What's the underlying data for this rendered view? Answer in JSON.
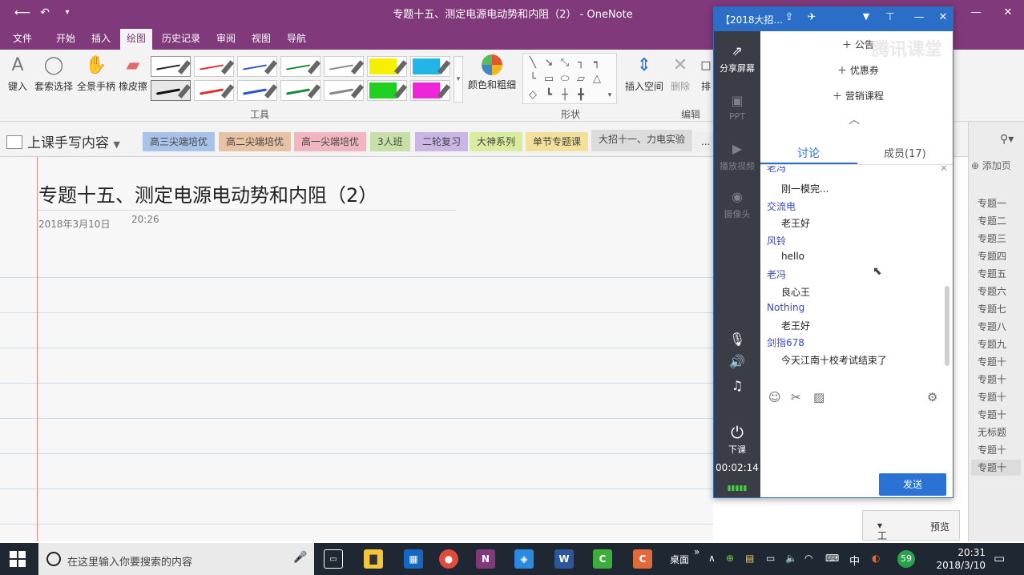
{
  "window": {
    "title": "专题十五、测定电源电动势和内阻（2） - OneNote"
  },
  "ribbon_tabs": [
    "文件",
    "开始",
    "插入",
    "绘图",
    "历史记录",
    "审阅",
    "视图",
    "导航"
  ],
  "ribbon": {
    "tool_buttons": [
      "键入",
      "套索选择",
      "全景手柄",
      "橡皮擦"
    ],
    "group_tools": "工具",
    "color_weight": "颜色和粗细",
    "group_shapes": "形状",
    "insert_space": "插入空间",
    "delete": "删除",
    "arrange": "排",
    "group_edit": "编辑"
  },
  "notebook": {
    "name": "上课手写内容",
    "sections": [
      "高三尖端培优",
      "高二尖端培优",
      "高一尖端培优",
      "3人班",
      "二轮复习",
      "大神系列",
      "单节专题课",
      "大招十一、力电实验",
      "..."
    ],
    "section_colors": [
      "#a7c4e8",
      "#e7c3a3",
      "#f1b6c2",
      "#c6e0a8",
      "#c9b6e4",
      "#d9ec9f",
      "#f3e19b",
      "#dcdcdc",
      "#eeeeee"
    ]
  },
  "page": {
    "title": "专题十五、测定电源电动势和内阻（2）",
    "date": "2018年3月10日",
    "time": "20:26"
  },
  "pagelist": {
    "add_page": "添加页",
    "items": [
      "专题一",
      "专题二",
      "专题三",
      "专题四",
      "专题五",
      "专题六",
      "专题七",
      "专题八",
      "专题九",
      "专题十",
      "专题十",
      "专题十",
      "专题十",
      "无标题",
      "专题十",
      "专题十"
    ]
  },
  "bottom": {
    "tools": "工具",
    "preview": "预览"
  },
  "tencent": {
    "title": "【2018大招...",
    "watermark": "腾讯课堂",
    "sidebar": [
      "分享屏幕",
      "PPT",
      "播放视频",
      "摄像头",
      "下课"
    ],
    "timer": "00:02:14",
    "links": [
      "公告",
      "优惠券",
      "营销课程"
    ],
    "tabs": [
      "讨论",
      "成员(17)"
    ],
    "messages": [
      {
        "user": "老冯",
        "text": "刚一模完..."
      },
      {
        "user": "交流电",
        "text": "老王好"
      },
      {
        "user": "风铃",
        "text": "hello"
      },
      {
        "user": "老冯",
        "text": "良心王"
      },
      {
        "user": "Nothing",
        "text": "老王好"
      },
      {
        "user": "剑指678",
        "text": "今天江南十校考试结束了"
      }
    ],
    "send": "发送"
  },
  "taskbar": {
    "search_placeholder": "在这里输入你要搜索的内容",
    "desktop": "桌面",
    "ime": "中",
    "badge": "59",
    "time": "20:31",
    "date": "2018/3/10"
  },
  "colors": {
    "onenote_purple": "#80397b",
    "tencent_blue": "#2a6ec8",
    "taskbar": "#1f2733"
  }
}
